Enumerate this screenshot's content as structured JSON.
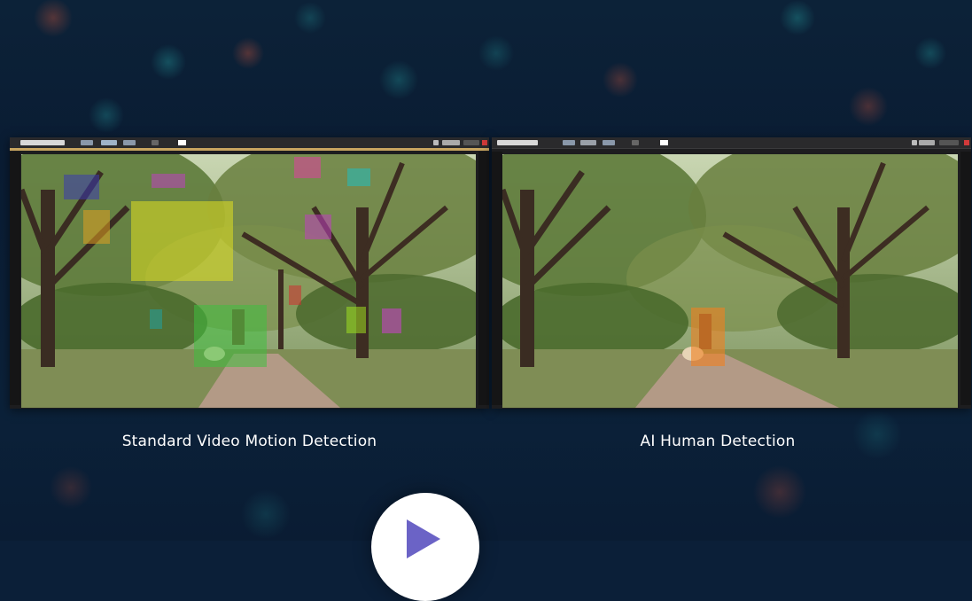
{
  "captions": {
    "left": "Standard Video Motion Detection",
    "right": "AI Human Detection"
  },
  "colors": {
    "page_bg": "#0b1f38",
    "caption_text": "#ffffff",
    "play_button": "#ffffff",
    "play_icon": "#6b63c6",
    "motion_boxes": [
      "#3a3ab0",
      "#c040c0",
      "#e0a020",
      "#e0e020",
      "#e040a0",
      "#20c0c0",
      "#c040c0",
      "#d03030",
      "#20a0a0",
      "#40c040",
      "#a0e020",
      "#d040d0"
    ],
    "human_box": "#f08020"
  },
  "icons": {
    "play": "play-icon"
  }
}
